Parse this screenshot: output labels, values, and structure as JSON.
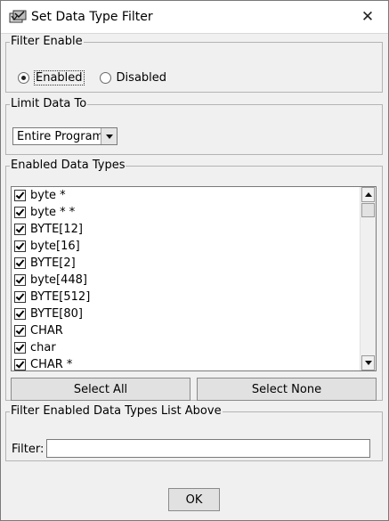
{
  "window": {
    "title": "Set Data Type Filter",
    "close_glyph": "✕"
  },
  "filter_enable": {
    "legend": "Filter Enable",
    "enabled_label": "Enabled",
    "disabled_label": "Disabled",
    "selected": "Enabled"
  },
  "limit_data_to": {
    "legend": "Limit Data To",
    "selected_value": "Entire Program"
  },
  "enabled_data_types": {
    "legend": "Enabled Data Types",
    "items": [
      {
        "label": "byte *",
        "checked": true
      },
      {
        "label": "byte * *",
        "checked": true
      },
      {
        "label": "BYTE[12]",
        "checked": true
      },
      {
        "label": "byte[16]",
        "checked": true
      },
      {
        "label": "BYTE[2]",
        "checked": true
      },
      {
        "label": "byte[448]",
        "checked": true
      },
      {
        "label": "BYTE[512]",
        "checked": true
      },
      {
        "label": "BYTE[80]",
        "checked": true
      },
      {
        "label": "CHAR",
        "checked": true
      },
      {
        "label": "char",
        "checked": true
      },
      {
        "label": "CHAR *",
        "checked": true
      }
    ],
    "select_all_label": "Select All",
    "select_none_label": "Select None"
  },
  "filter_list": {
    "legend": "Filter Enabled Data Types List Above",
    "filter_label": "Filter:",
    "filter_value": ""
  },
  "footer": {
    "ok_label": "OK"
  },
  "icons": [
    "app-icon",
    "close-icon",
    "chevron-down-icon",
    "scroll-up-icon",
    "scroll-down-icon",
    "check-icon"
  ]
}
